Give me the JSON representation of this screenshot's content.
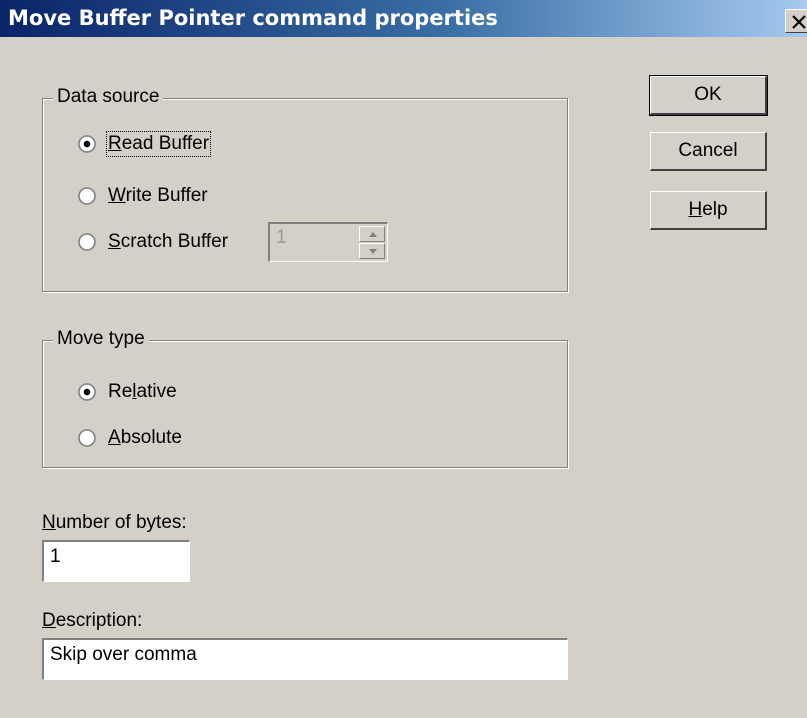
{
  "window": {
    "title": "Move Buffer Pointer command properties",
    "close_label": "X"
  },
  "data_source": {
    "legend": "Data source",
    "options": [
      {
        "mnemonic": "R",
        "rest": "ead Buffer",
        "checked": true
      },
      {
        "mnemonic": "W",
        "rest": "rite Buffer",
        "checked": false
      },
      {
        "mnemonic": "S",
        "rest": "cratch Buffer",
        "checked": false
      }
    ],
    "scratch_value": "1"
  },
  "move_type": {
    "legend": "Move type",
    "options": [
      {
        "before": "Re",
        "mnemonic": "l",
        "rest": "ative",
        "checked": true
      },
      {
        "before": "",
        "mnemonic": "A",
        "rest": "bsolute",
        "checked": false
      }
    ]
  },
  "number_of_bytes": {
    "label_mnemonic": "N",
    "label_rest": "umber of bytes:",
    "value": "1"
  },
  "description": {
    "label_mnemonic": "D",
    "label_rest": "escription:",
    "value": "Skip over comma"
  },
  "buttons": {
    "ok": "OK",
    "cancel": "Cancel",
    "help_mnemonic": "H",
    "help_rest": "elp"
  }
}
